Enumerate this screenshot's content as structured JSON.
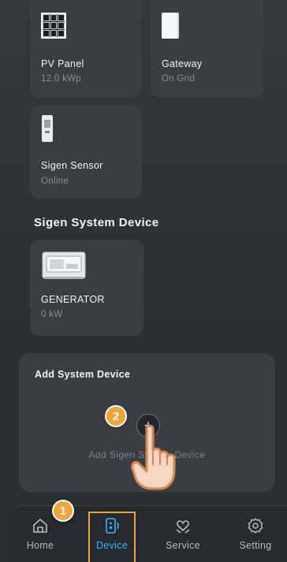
{
  "devices_top": [
    {
      "name": "PV Panel",
      "status": "12.0 kWp",
      "icon": "pv-panel-icon"
    },
    {
      "name": "Gateway",
      "status": "On Grid",
      "icon": "gateway-icon"
    },
    {
      "name": "Sigen Sensor",
      "status": "Online",
      "icon": "sensor-icon"
    }
  ],
  "system_section": {
    "title": "Sigen System Device",
    "devices": [
      {
        "name": "GENERATOR",
        "status": "0 kW",
        "icon": "generator-icon"
      }
    ]
  },
  "add_card": {
    "title": "Add System Device",
    "plus_symbol": "+",
    "label": "Add Sigen System Device"
  },
  "tabs": [
    {
      "label": "Home",
      "icon": "home-icon"
    },
    {
      "label": "Device",
      "icon": "device-icon",
      "active": true
    },
    {
      "label": "Service",
      "icon": "service-icon"
    },
    {
      "label": "Setting",
      "icon": "gear-icon"
    }
  ],
  "steps": [
    "1",
    "2"
  ],
  "colors": {
    "accent": "#3bb7ff",
    "highlight": "#e7a13d",
    "badge": "#f0a53a",
    "card": "#3a3d42",
    "background": "#2a2d31"
  }
}
